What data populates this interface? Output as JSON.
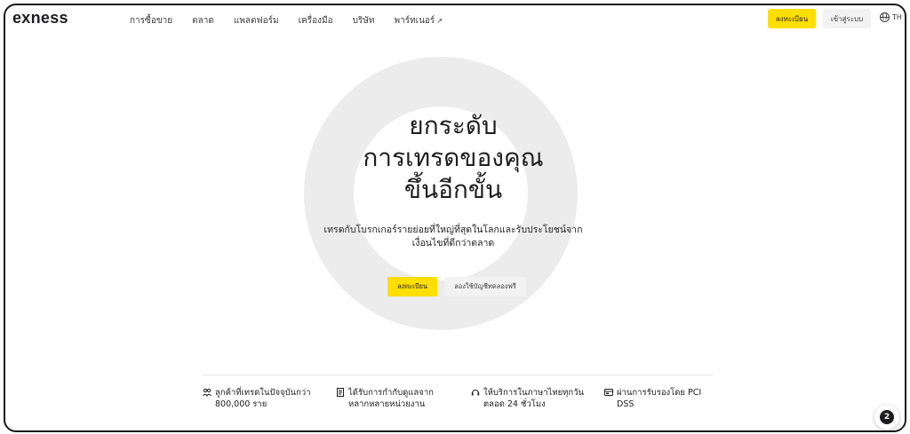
{
  "header": {
    "logo": "exness",
    "nav": [
      {
        "label": "การซื้อขาย"
      },
      {
        "label": "ตลาด"
      },
      {
        "label": "แพลตฟอร์ม"
      },
      {
        "label": "เครื่องมือ"
      },
      {
        "label": "บริษัท"
      },
      {
        "label": "พาร์ทเนอร์",
        "arrow": "↗"
      }
    ],
    "register_label": "ลงทะเบียน",
    "login_label": "เข้าสู่ระบบ",
    "language": "TH"
  },
  "hero": {
    "title_line1": "ยกระดับ",
    "title_line2": "การเทรดของคุณ",
    "title_line3": "ขึ้นอีกขั้น",
    "subtitle_line1": "เทรดกับโบรกเกอร์รายย่อยที่ใหญ่ที่สุดในโลกและรับประโยชน์จาก",
    "subtitle_line2": "เงื่อนไขที่ดีกว่าตลาด",
    "register_label": "ลงทะเบียน",
    "demo_label": "ลองใช้บัญชีทดลองฟรี"
  },
  "features": [
    {
      "icon": "users-icon",
      "line1": "ลูกค้าที่เทรดในปัจจุบันกว่า",
      "line2": "800,000 ราย"
    },
    {
      "icon": "document-icon",
      "line1": "ได้รับการกำกับดูแลจาก",
      "line2": "หลากหลายหน่วยงาน"
    },
    {
      "icon": "headset-icon",
      "line1": "ให้บริการในภาษาไทยทุกวัน",
      "line2": "ตลอด 24 ชั่วโมง"
    },
    {
      "icon": "shield-card-icon",
      "line1": "ผ่านการรับรองโดย PCI",
      "line2": "DSS"
    }
  ],
  "chat": {
    "badge": "2"
  },
  "colors": {
    "accent": "#ffde02",
    "ring": "#ececec",
    "text": "#1d1d1f"
  }
}
